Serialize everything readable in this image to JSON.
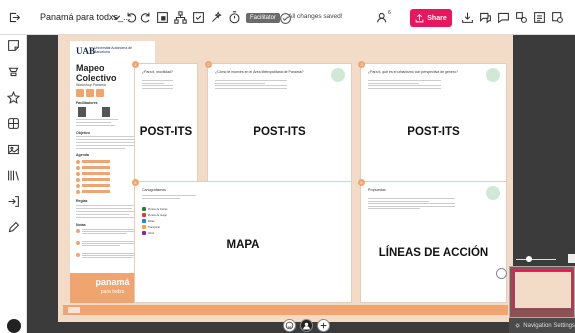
{
  "toolbar": {
    "board_title": "Panamá para todxs_...",
    "facilitator_label": "Facilitator",
    "saved_label": "All changes saved!",
    "user_count": "6",
    "share_label": "Share"
  },
  "left_panel": {
    "logo": "UAB",
    "university": "Universitat Autònoma de Barcelona",
    "title": "Mapeo Colectivo",
    "subtitle": "Workshop Panama",
    "facilitators_heading": "Facilitadores",
    "objective_heading": "Objetivo",
    "agenda_heading": "Agenda",
    "rules_heading": "Reglas",
    "notes_heading": "Notas",
    "brand": "panamá",
    "brand_sub": "para todxs"
  },
  "frames": [
    {
      "num": "1",
      "question": "¿Para ti, movilidad?",
      "big": "POST-ITS"
    },
    {
      "num": "2",
      "question": "¿Cómo te mueves en el Área Metropolitana de Panamá?",
      "big": "POST-ITS"
    },
    {
      "num": "3",
      "question": "¿Para ti, qué es el urbanismo con perspectiva de género?",
      "big": "POST-ITS"
    },
    {
      "num": "4",
      "question": "Cartografiamos",
      "big": "MAPA"
    },
    {
      "num": "5",
      "question": "Propuestas",
      "big": "LÍNEAS DE ACCIÓN"
    }
  ],
  "map_legend": [
    {
      "label": "Puntos de interés",
      "color": "#2e7d32"
    },
    {
      "label": "Puntos de riesgo",
      "color": "#e53935"
    },
    {
      "label": "Rutas",
      "color": "#1e88e5"
    },
    {
      "label": "Transporte",
      "color": "#f9a825"
    },
    {
      "label": "Otros",
      "color": "#8e24aa"
    }
  ],
  "navigation": {
    "label": "Navigation Settings"
  }
}
